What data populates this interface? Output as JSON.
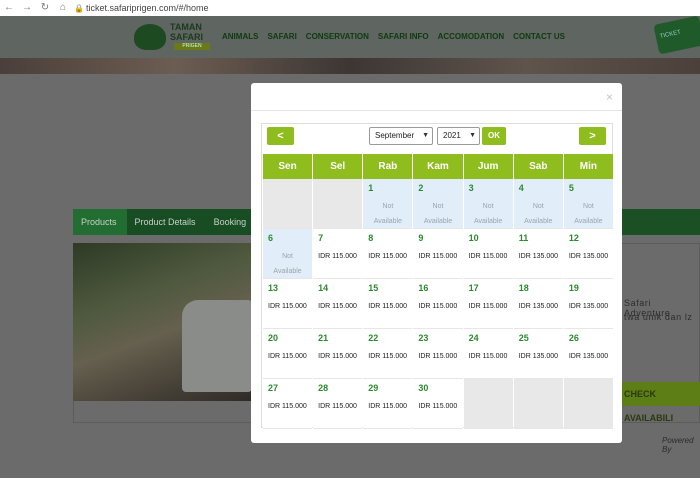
{
  "browser": {
    "url": "ticket.safariprigen.com/#/home"
  },
  "site": {
    "logo_line1": "TAMAN",
    "logo_line2": "SAFARI",
    "logo_sub": "PRIGEN",
    "nav": [
      "ANIMALS",
      "SAFARI",
      "CONSERVATION",
      "SAFARI INFO",
      "ACCOMODATION",
      "CONTACT US"
    ],
    "ticket_badge": "TICKET",
    "steps": [
      "Products",
      "Product Details",
      "Booking"
    ],
    "bg_text_1": "Safari Adventure",
    "bg_text_2": "twa unik dan lz",
    "check_button": "CHECK AVAILABILI",
    "powered": "Powered By"
  },
  "modal": {
    "close": "×",
    "month": "September",
    "year": "2021",
    "ok": "OK",
    "prev": "<",
    "next": ">",
    "weekdays": [
      "Sen",
      "Sel",
      "Rab",
      "Kam",
      "Jum",
      "Sab",
      "Min"
    ],
    "not_available": "Not Available",
    "days": [
      {
        "num": "",
        "status": "empty"
      },
      {
        "num": "",
        "status": "empty"
      },
      {
        "num": "1",
        "status": "na"
      },
      {
        "num": "2",
        "status": "na"
      },
      {
        "num": "3",
        "status": "na"
      },
      {
        "num": "4",
        "status": "na"
      },
      {
        "num": "5",
        "status": "na"
      },
      {
        "num": "6",
        "status": "na"
      },
      {
        "num": "7",
        "price": "IDR 115.000"
      },
      {
        "num": "8",
        "price": "IDR 115.000"
      },
      {
        "num": "9",
        "price": "IDR 115.000"
      },
      {
        "num": "10",
        "price": "IDR 115.000"
      },
      {
        "num": "11",
        "price": "IDR 135.000"
      },
      {
        "num": "12",
        "price": "IDR 135.000"
      },
      {
        "num": "13",
        "price": "IDR 115.000"
      },
      {
        "num": "14",
        "price": "IDR 115.000"
      },
      {
        "num": "15",
        "price": "IDR 115.000"
      },
      {
        "num": "16",
        "price": "IDR 115.000"
      },
      {
        "num": "17",
        "price": "IDR 115.000"
      },
      {
        "num": "18",
        "price": "IDR 135.000"
      },
      {
        "num": "19",
        "price": "IDR 135.000"
      },
      {
        "num": "20",
        "price": "IDR 115.000"
      },
      {
        "num": "21",
        "price": "IDR 115.000"
      },
      {
        "num": "22",
        "price": "IDR 115.000"
      },
      {
        "num": "23",
        "price": "IDR 115.000"
      },
      {
        "num": "24",
        "price": "IDR 115.000"
      },
      {
        "num": "25",
        "price": "IDR 135.000"
      },
      {
        "num": "26",
        "price": "IDR 135.000"
      },
      {
        "num": "27",
        "price": "IDR 115.000"
      },
      {
        "num": "28",
        "price": "IDR 115.000"
      },
      {
        "num": "29",
        "price": "IDR 115.000"
      },
      {
        "num": "30",
        "price": "IDR 115.000"
      },
      {
        "num": "",
        "status": "empty"
      },
      {
        "num": "",
        "status": "empty"
      },
      {
        "num": "",
        "status": "empty"
      }
    ]
  }
}
